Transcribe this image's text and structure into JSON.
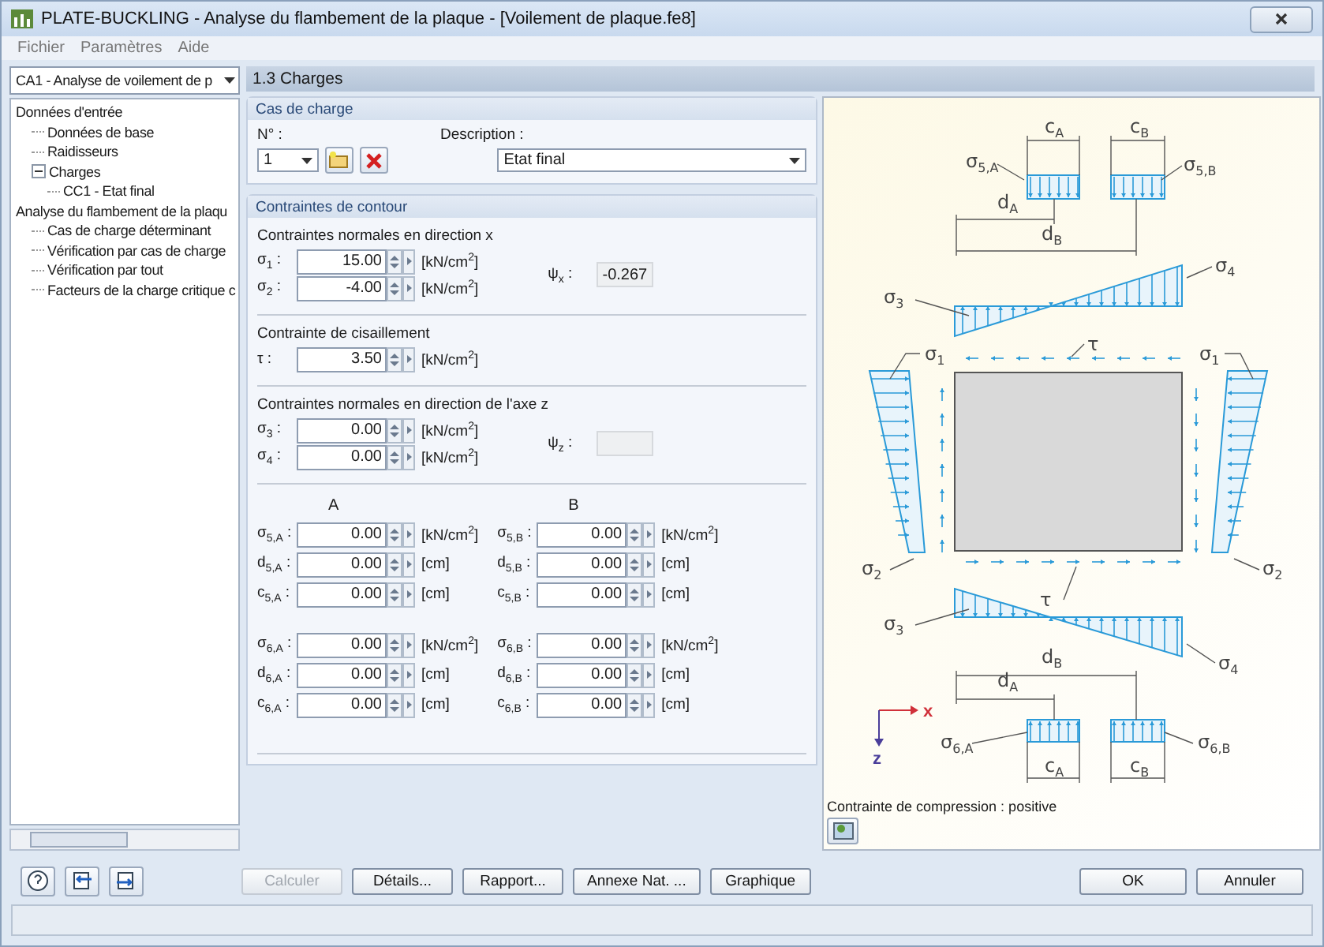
{
  "window": {
    "title": "PLATE-BUCKLING - Analyse du flambement de la plaque - [Voilement de plaque.fe8]"
  },
  "menu": [
    "Fichier",
    "Paramètres",
    "Aide"
  ],
  "case_selector": {
    "value": "CA1 - Analyse de voilement de p"
  },
  "tree": [
    {
      "label": "Données d'entrée",
      "children": [
        {
          "label": "Données de base"
        },
        {
          "label": "Raidisseurs"
        },
        {
          "label": "Charges",
          "expanded": true,
          "children": [
            {
              "label": "CC1 - Etat final"
            }
          ]
        }
      ]
    },
    {
      "label": "Analyse du flambement de la plaqu",
      "children": [
        {
          "label": "Cas de charge déterminant"
        },
        {
          "label": "Vérification par cas de charge"
        },
        {
          "label": "Vérification par tout"
        },
        {
          "label": "Facteurs de la charge critique c"
        }
      ]
    }
  ],
  "section_header": "1.3 Charges",
  "load_case": {
    "title": "Cas de charge",
    "number_label": "N° :",
    "number": "1",
    "description_label": "Description :",
    "description": "Etat final"
  },
  "contour": {
    "title": "Contraintes de contour",
    "groups": [
      {
        "title": "Contraintes normales en direction x",
        "fields": [
          {
            "label": "σ$_{1}$ :",
            "value": "15.00",
            "unit": "[kN/cm$^{2}$]"
          },
          {
            "label": "σ$_{2}$ :",
            "value": "-4.00",
            "unit": "[kN/cm$^{2}$]"
          }
        ],
        "ratio": {
          "label": "ψ$_{x}$ :",
          "value": "-0.267"
        }
      },
      {
        "title": "Contrainte de cisaillement",
        "fields": [
          {
            "label": "τ :",
            "value": "3.50",
            "unit": "[kN/cm$^{2}$]"
          }
        ]
      },
      {
        "title": "Contraintes normales en direction de l'axe z",
        "fields": [
          {
            "label": "σ$_{3}$ :",
            "value": "0.00",
            "unit": "[kN/cm$^{2}$]"
          },
          {
            "label": "σ$_{4}$ :",
            "value": "0.00",
            "unit": "[kN/cm$^{2}$]"
          }
        ],
        "ratio": {
          "label": "ψ$_{z}$ :"
        }
      }
    ],
    "local": [
      {
        "heading": "A",
        "blocks": [
          [
            {
              "label": "σ$_{5,A}$ :",
              "value": "0.00",
              "unit": "[kN/cm$^{2}$]"
            },
            {
              "label": "d$_{5,A}$ :",
              "value": "0.00",
              "unit": "[cm]"
            },
            {
              "label": "c$_{5,A}$ :",
              "value": "0.00",
              "unit": "[cm]"
            }
          ],
          [
            {
              "label": "σ$_{6,A}$ :",
              "value": "0.00",
              "unit": "[kN/cm$^{2}$]"
            },
            {
              "label": "d$_{6,A}$ :",
              "value": "0.00",
              "unit": "[cm]"
            },
            {
              "label": "c$_{6,A}$ :",
              "value": "0.00",
              "unit": "[cm]"
            }
          ]
        ]
      },
      {
        "heading": "B",
        "blocks": [
          [
            {
              "label": "σ$_{5,B}$ :",
              "value": "0.00",
              "unit": "[kN/cm$^{2}$]"
            },
            {
              "label": "d$_{5,B}$ :",
              "value": "0.00",
              "unit": "[cm]"
            },
            {
              "label": "c$_{5,B}$ :",
              "value": "0.00",
              "unit": "[cm]"
            }
          ],
          [
            {
              "label": "σ$_{6,B}$ :",
              "value": "0.00",
              "unit": "[kN/cm$^{2}$]"
            },
            {
              "label": "d$_{6,B}$ :",
              "value": "0.00",
              "unit": "[cm]"
            },
            {
              "label": "c$_{6,B}$ :",
              "value": "0.00",
              "unit": "[cm]"
            }
          ]
        ]
      }
    ]
  },
  "diagram": {
    "labels": [
      {
        "symbol": "c",
        "sub": "A"
      },
      {
        "symbol": "c",
        "sub": "B"
      },
      {
        "symbol": "σ",
        "sub": "5,A"
      },
      {
        "symbol": "σ",
        "sub": "5,B"
      },
      {
        "symbol": "d",
        "sub": "A"
      },
      {
        "symbol": "d",
        "sub": "B"
      },
      {
        "symbol": "σ",
        "sub": "3"
      },
      {
        "symbol": "σ",
        "sub": "4"
      },
      {
        "symbol": "σ",
        "sub": "1"
      },
      {
        "symbol": "τ"
      },
      {
        "symbol": "σ",
        "sub": "1"
      },
      {
        "symbol": "σ",
        "sub": "2"
      },
      {
        "symbol": "σ",
        "sub": "2"
      },
      {
        "symbol": "τ"
      },
      {
        "symbol": "σ",
        "sub": "3"
      },
      {
        "symbol": "σ",
        "sub": "4"
      },
      {
        "symbol": "d",
        "sub": "B"
      },
      {
        "symbol": "d",
        "sub": "A"
      },
      {
        "symbol": "σ",
        "sub": "6,A"
      },
      {
        "symbol": "σ",
        "sub": "6,B"
      },
      {
        "symbol": "c",
        "sub": "A"
      },
      {
        "symbol": "c",
        "sub": "B"
      }
    ],
    "axes": {
      "x": "x",
      "z": "z"
    },
    "caption": "Contrainte de compression : positive"
  },
  "buttons": [
    {
      "label": "Calculer",
      "disabled": true
    },
    {
      "label": "Détails...",
      "disabled": false
    },
    {
      "label": "Rapport...",
      "disabled": false
    },
    {
      "label": "Annexe Nat. ...",
      "disabled": false
    },
    {
      "label": "Graphique",
      "disabled": false
    }
  ],
  "dialog_buttons": [
    "OK",
    "Annuler"
  ]
}
